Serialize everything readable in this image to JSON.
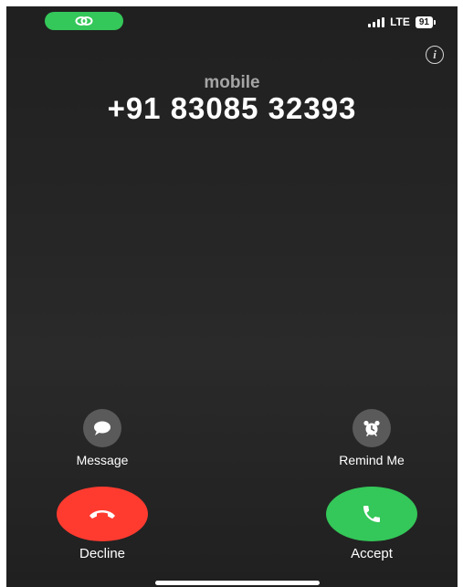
{
  "status_bar": {
    "network": "LTE",
    "battery": "91",
    "call_pill_icon": "link-icon",
    "call_pill_color": "#34c759"
  },
  "info_icon": "i",
  "caller": {
    "label": "mobile",
    "number": "+91 83085 32393"
  },
  "actions": {
    "message": {
      "label": "Message",
      "icon": "speech-bubble-icon"
    },
    "remind": {
      "label": "Remind Me",
      "icon": "alarm-clock-icon"
    },
    "decline": {
      "label": "Decline",
      "icon": "phone-down-icon",
      "color": "#ff3b30"
    },
    "accept": {
      "label": "Accept",
      "icon": "phone-icon",
      "color": "#34c759"
    }
  }
}
